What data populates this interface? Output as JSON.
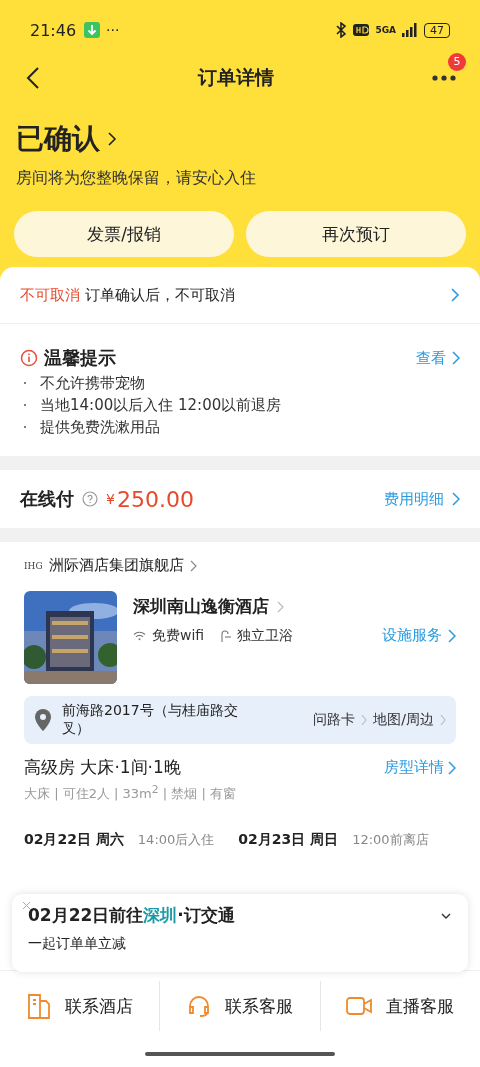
{
  "status_bar": {
    "time": "21:46",
    "more": "···",
    "network": "5GA",
    "battery": "47"
  },
  "header": {
    "title": "订单详情",
    "badge": "5"
  },
  "order_status": {
    "title": "已确认",
    "subtitle": "房间将为您整晚保留，请安心入住"
  },
  "actions": [
    "发票/报销",
    "再次预订"
  ],
  "cancel_policy": {
    "tag": "不可取消",
    "text": "订单确认后，不可取消"
  },
  "tips": {
    "title": "温馨提示",
    "link": "查看",
    "items": [
      "不允许携带宠物",
      "当地14:00以后入住 12:00以前退房",
      "提供免费洗漱用品"
    ]
  },
  "payment": {
    "label": "在线付",
    "currency": "¥",
    "amount": "250.00",
    "link": "费用明细"
  },
  "hotel": {
    "brand_logo": "IHG",
    "brand": "洲际酒店集团旗舰店",
    "image": {
      "kind": "picture"
    },
    "name": "深圳南山逸衡酒店",
    "amenities": [
      {
        "kind": "wifi",
        "label": "免费wifi"
      },
      {
        "kind": "shower",
        "label": "独立卫浴"
      }
    ],
    "facilities_link": "设施服务",
    "address": "前海路2017号（与桂庙路交叉）",
    "address_links": [
      "问路卡",
      "地图/周边"
    ]
  },
  "room": {
    "title": "高级房 大床·1间·1晚",
    "details": "大床 | 可住2人 | 33m$^{2}$ | 禁烟 | 有窗",
    "link": "房型详情"
  },
  "stay": {
    "checkin_date": "02月22日 周六",
    "checkin_time": "14:00后入住",
    "checkout_date": "02月23日 周日",
    "checkout_time": "12:00前离店"
  },
  "promo": {
    "prefix": "02月22日前往",
    "city": "深圳",
    "suffix": "·订交通",
    "subtitle": "一起订单单立减"
  },
  "bottom_bar": [
    {
      "kind": "hotel",
      "label": "联系酒店"
    },
    {
      "kind": "headset",
      "label": "联系客服"
    },
    {
      "kind": "video",
      "label": "直播客服"
    }
  ]
}
